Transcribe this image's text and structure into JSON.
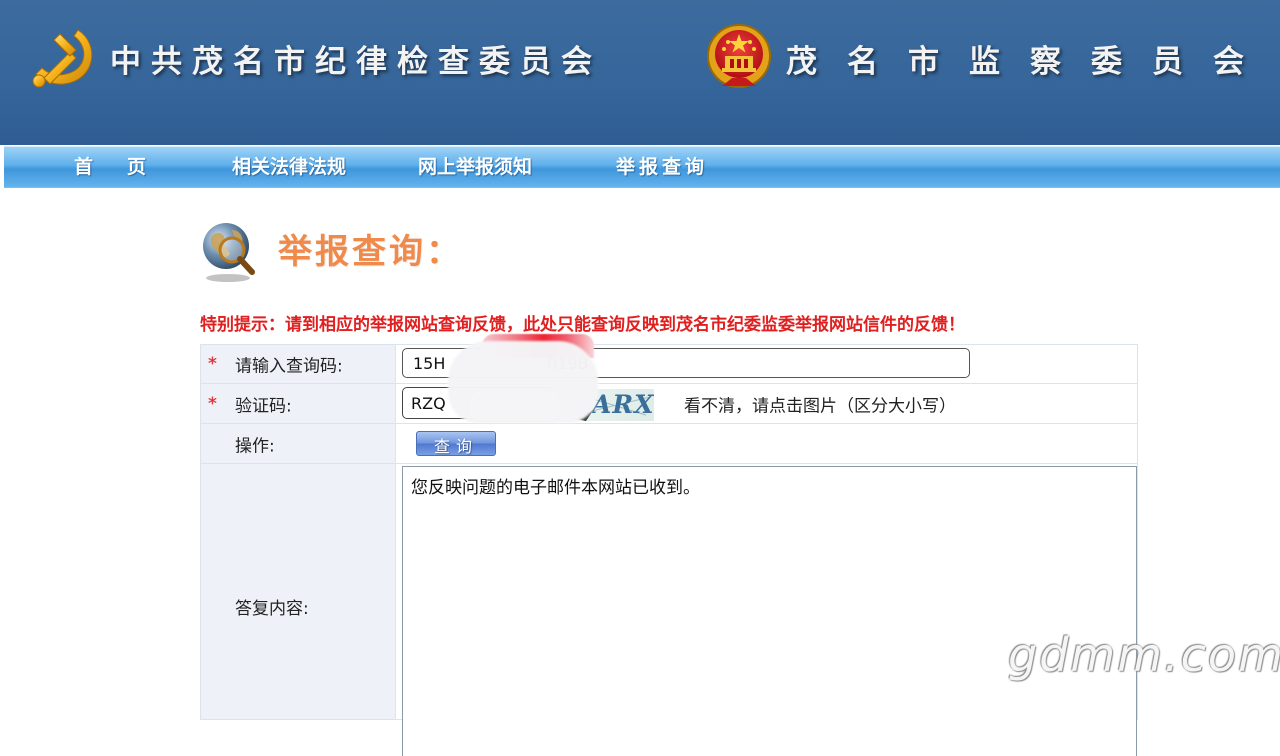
{
  "header": {
    "title_left": "中共茂名市纪律检查委员会",
    "title_right": "茂名市监察委员会",
    "left_emblem_icon": "party-emblem-icon",
    "right_emblem_icon": "national-emblem-icon"
  },
  "nav": {
    "items": [
      {
        "label": "首页"
      },
      {
        "label": "相关法律法规"
      },
      {
        "label": "网上举报须知"
      },
      {
        "label": "举报查询"
      }
    ]
  },
  "page": {
    "heading": "举报查询：",
    "heading_icon": "globe-search-icon",
    "notice": "特别提示：请到相应的举报网站查询反馈，此处只能查询反映到茂名市纪委监委举报网站信件的反馈！"
  },
  "form": {
    "required_mark": "*",
    "code_label": "请输入查询码:",
    "code_value": "15H                    019B",
    "captcha_label": "验证码:",
    "captcha_value": "RZQ",
    "captcha_image_text": "ARX",
    "captcha_hint": "看不清，请点击图片（区分大小写）",
    "operation_label": "操作:",
    "query_button": "查询",
    "reply_label": "答复内容:",
    "reply_text": "您反映问题的电子邮件本网站已收到。"
  },
  "watermark": "gdmm.com",
  "colors": {
    "header_bg": "#3d6b9e",
    "nav_bg": "#5eb0ec",
    "heading": "#f08a4b",
    "notice": "#e02020",
    "label_bg": "#eef2f8",
    "button": "#5f86d8"
  }
}
